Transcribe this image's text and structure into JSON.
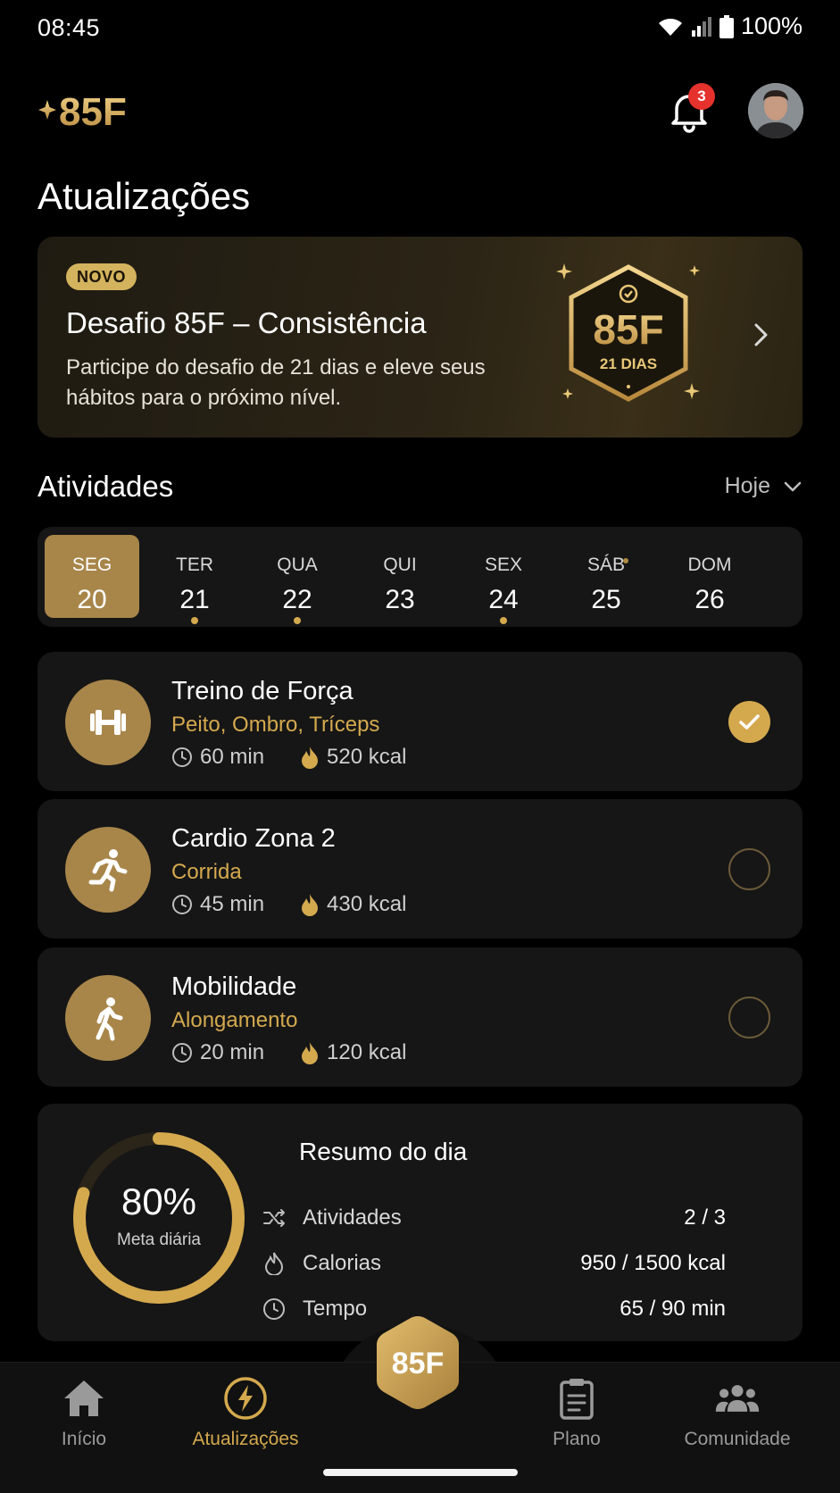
{
  "status_bar": {
    "time": "08:45",
    "battery": "100%"
  },
  "header": {
    "logo_text": "85F",
    "notifications_count": "3"
  },
  "page_title": "Atualizações",
  "promo": {
    "badge": "NOVO",
    "title": "Desafio 85F – Consistência",
    "description": "Participe do desafio de 21 dias e eleve seus hábitos para o próximo nível.",
    "emblem_brand": "85F",
    "emblem_days": "21 DIAS"
  },
  "activities": {
    "title": "Atividades",
    "filter_label": "Hoje",
    "week": [
      {
        "name": "SEG",
        "date": "20",
        "selected": true,
        "dot": false
      },
      {
        "name": "TER",
        "date": "21",
        "selected": false,
        "dot": true
      },
      {
        "name": "QUA",
        "date": "22",
        "selected": false,
        "dot": true
      },
      {
        "name": "QUI",
        "date": "23",
        "selected": false,
        "dot": false
      },
      {
        "name": "SEX",
        "date": "24",
        "selected": false,
        "dot": true
      },
      {
        "name": "SÁB",
        "date": "25",
        "selected": false,
        "dot": false
      },
      {
        "name": "DOM",
        "date": "26",
        "selected": false,
        "dot": false
      }
    ],
    "items": [
      {
        "name": "Treino de Força",
        "subtitle": "Peito, Ombro, Tríceps",
        "duration": "60 min",
        "calories": "520 kcal",
        "icon": "dumbbell-icon",
        "done": true
      },
      {
        "name": "Cardio Zona 2",
        "subtitle": "Corrida",
        "duration": "45 min",
        "calories": "430 kcal",
        "icon": "runner-icon",
        "done": false
      },
      {
        "name": "Mobilidade",
        "subtitle": "Alongamento",
        "duration": "20 min",
        "calories": "120 kcal",
        "icon": "walker-icon",
        "done": false
      }
    ]
  },
  "summary": {
    "percent_text": "80%",
    "progress": 0.8,
    "label": "Meta diária",
    "title": "Resumo do dia",
    "rows": [
      {
        "label": "Atividades",
        "value": "2 / 3",
        "icon": "shuffle-icon"
      },
      {
        "label": "Calorias",
        "value": "950 / 1500 kcal",
        "icon": "flame-icon"
      },
      {
        "label": "Tempo",
        "value": "65 / 90 min",
        "icon": "clock-icon"
      }
    ]
  },
  "nav": {
    "items": [
      {
        "label": "Início",
        "icon": "home-icon",
        "active": false
      },
      {
        "label": "Atualizações",
        "icon": "bolt-icon",
        "active": true
      },
      {
        "label": "Plano",
        "icon": "clipboard-icon",
        "active": false
      },
      {
        "label": "Comunidade",
        "icon": "community-icon",
        "active": false
      }
    ],
    "fab_text": "85F"
  },
  "colors": {
    "accent": "#d4a94e",
    "accent_dark": "#a8864a",
    "card": "#161616",
    "background": "#000000"
  }
}
